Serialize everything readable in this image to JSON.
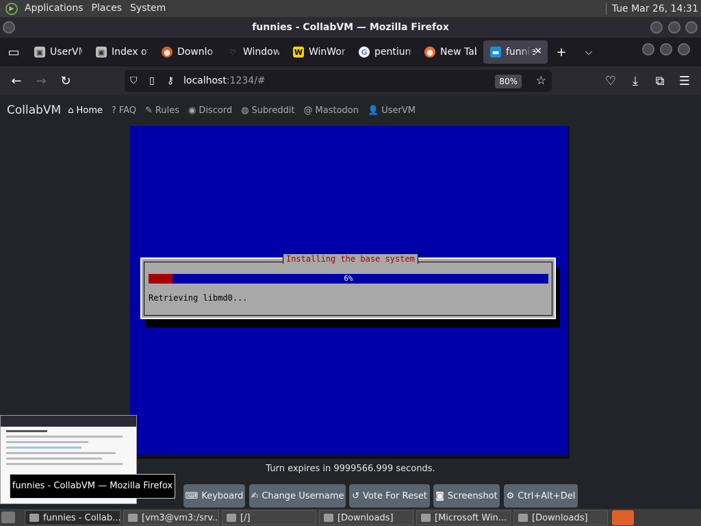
{
  "top_panel": {
    "menus": [
      "Applications",
      "Places",
      "System"
    ],
    "clock": "Tue Mar 26, 14:31"
  },
  "window": {
    "title": "funnies - CollabVM — Mozilla Firefox"
  },
  "tabs": [
    {
      "label": "UserVM",
      "icon": "computer-icon"
    },
    {
      "label": "Index of",
      "icon": "computer-icon"
    },
    {
      "label": "Downloa",
      "icon": "firefox-alt-icon"
    },
    {
      "label": "Window",
      "icon": "window-icon"
    },
    {
      "label": "WinWor",
      "icon": "winworld-icon"
    },
    {
      "label": "pentium",
      "icon": "google-icon"
    },
    {
      "label": "New Tab",
      "icon": "firefox-icon"
    },
    {
      "label": "funnie",
      "icon": "monitor-icon"
    }
  ],
  "navbar": {
    "url_host": "localhost",
    "url_rest": ":1234/#",
    "zoom": "80%"
  },
  "site": {
    "brand": "CollabVM",
    "links": [
      "Home",
      "FAQ",
      "Rules",
      "Discord",
      "Subreddit",
      "Mastodon",
      "UserVM"
    ]
  },
  "vm": {
    "dialog_title": "Installing the base system",
    "progress_label": "6%",
    "progress_fraction": 0.06,
    "status": "Retrieving libmd0..."
  },
  "turn_text": "Turn expires in 9999566.999 seconds.",
  "controls": [
    "Keyboard",
    "Change Username",
    "Vote For Reset",
    "Screenshot",
    "Ctrl+Alt+Del"
  ],
  "tooltip": "funnies - CollabVM — Mozilla Firefox",
  "taskbar": [
    "funnies - Collab...",
    "[vm3@vm3:/srv...",
    "[/]",
    "[Downloads]",
    "[Microsoft Win...",
    "[Downloads]"
  ],
  "colors": {
    "vm_blue": "#0000a8",
    "vm_red": "#a80000",
    "dialog_gray": "#a8a8a8",
    "page_bg": "#212529"
  }
}
